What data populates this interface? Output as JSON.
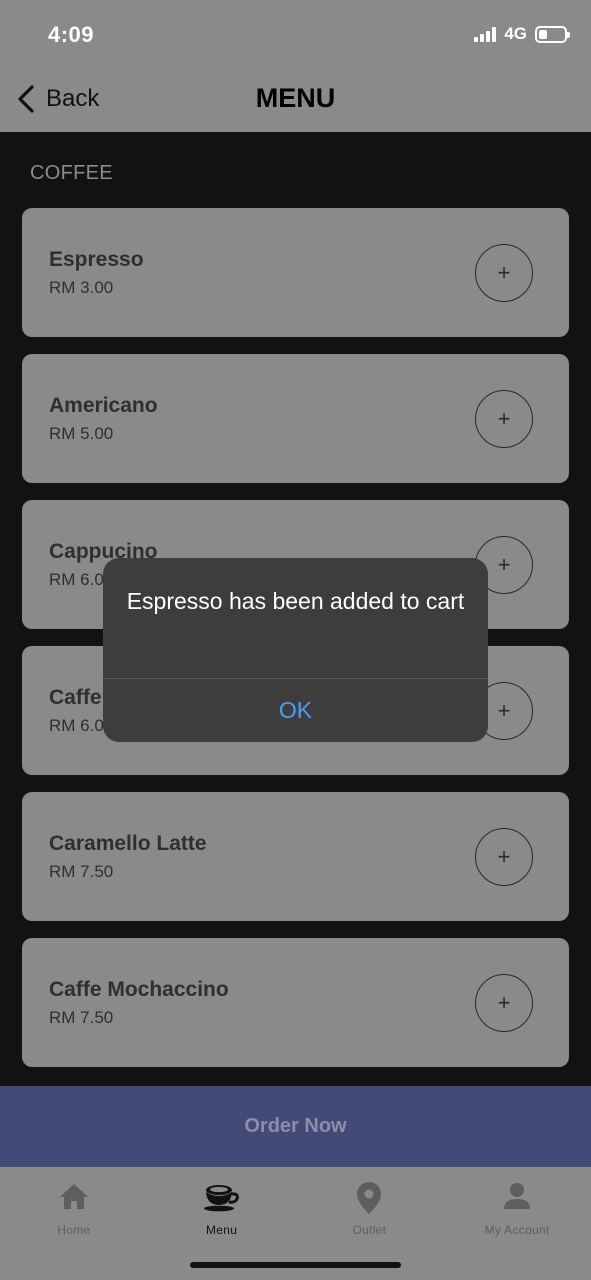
{
  "status_bar": {
    "time": "4:09",
    "network": "4G",
    "battery_level": 0.35
  },
  "header": {
    "back_label": "Back",
    "title": "MENU"
  },
  "section_title": "COFFEE",
  "items": [
    {
      "name": "Espresso",
      "price": "RM 3.00"
    },
    {
      "name": "Americano",
      "price": "RM 5.00"
    },
    {
      "name": "Cappucino",
      "price": "RM 6.0"
    },
    {
      "name": "Caffe",
      "price": "RM 6.0"
    },
    {
      "name": "Caramello Latte",
      "price": "RM 7.50"
    },
    {
      "name": "Caffe Mochaccino",
      "price": "RM 7.50"
    }
  ],
  "add_symbol": "+",
  "order_button": "Order Now",
  "nav": [
    {
      "label": "Home",
      "icon": "home-icon"
    },
    {
      "label": "Menu",
      "icon": "coffee-cup-icon",
      "active": true
    },
    {
      "label": "Outlet",
      "icon": "location-pin-icon"
    },
    {
      "label": "My Account",
      "icon": "person-icon"
    }
  ],
  "alert": {
    "message": "Espresso has been added to cart",
    "ok_label": "OK"
  },
  "colors": {
    "accent": "#434a78",
    "link_blue": "#4a9cf0",
    "alert_bg": "#3d3d3d"
  }
}
